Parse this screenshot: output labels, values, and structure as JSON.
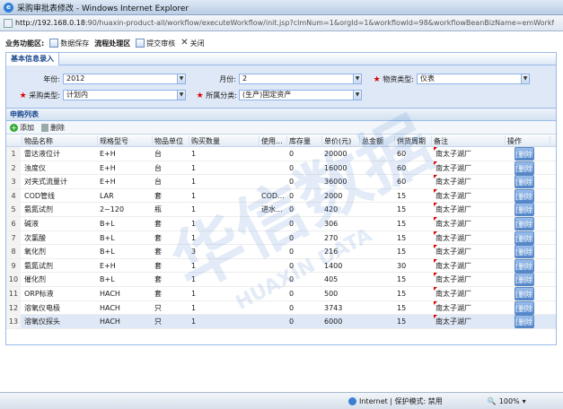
{
  "window": {
    "title": "采购审批表修改 - Windows Internet Explorer",
    "url_host": "http://192.168.0.18",
    "url_rest": ":90/huaxin-product-all/workflow/executeWorkflow/init.jsp?clmNum=1&orgId=1&workflowId=98&workflowBeanBizName=emWorkflowBiz&app"
  },
  "toolbar": {
    "area1_label": "业务功能区:",
    "save_label": "数据保存",
    "area2_label": "流程处理区",
    "submit_label": "提交审核",
    "close_label": "关闭"
  },
  "basic_info": {
    "tab_label": "基本信息录入",
    "year_label": "年份:",
    "year_value": "2012",
    "month_label": "月份:",
    "month_value": "2",
    "material_type_label": "物资类型:",
    "material_type_value": "仪表",
    "purchase_type_label": "采购类型:",
    "purchase_type_value": "计划内",
    "category_label": "所属分类:",
    "category_value": "(生产)固定资产"
  },
  "purchase_list": {
    "header": "申购列表",
    "add_label": "添加",
    "delete_label": "删除",
    "columns": [
      "物品名称",
      "规格型号",
      "物品单位",
      "购买数量",
      "使用...",
      "库存量",
      "单价(元)",
      "总金额",
      "供货周期",
      "备注",
      "操作"
    ],
    "rows": [
      {
        "no": "1",
        "name": "雷达液位计",
        "model": "E+H",
        "unit": "台",
        "qty": "1",
        "use": "",
        "stock": "0",
        "price": "20000",
        "total": "",
        "period": "60",
        "note": "南太子湖厂",
        "op": "[删除]"
      },
      {
        "no": "2",
        "name": "浊度仪",
        "model": "E+H",
        "unit": "台",
        "qty": "1",
        "use": "",
        "stock": "0",
        "price": "16000",
        "total": "",
        "period": "60",
        "note": "南太子湖厂",
        "op": "[删除]"
      },
      {
        "no": "3",
        "name": "对夹式流量计",
        "model": "E+H",
        "unit": "台",
        "qty": "1",
        "use": "",
        "stock": "0",
        "price": "36000",
        "total": "",
        "period": "60",
        "note": "南太子湖厂",
        "op": "[删除]"
      },
      {
        "no": "4",
        "name": "COD管线",
        "model": "LAR",
        "unit": "套",
        "qty": "1",
        "use": "COD...",
        "stock": "0",
        "price": "2000",
        "total": "",
        "period": "15",
        "note": "南太子湖厂",
        "op": "[删除]"
      },
      {
        "no": "5",
        "name": "氨氮试剂",
        "model": "2~120",
        "unit": "瓶",
        "qty": "1",
        "use": "进水...",
        "stock": "0",
        "price": "420",
        "total": "",
        "period": "15",
        "note": "南太子湖厂",
        "op": "[删除]"
      },
      {
        "no": "6",
        "name": "碱液",
        "model": "B+L",
        "unit": "套",
        "qty": "1",
        "use": "",
        "stock": "0",
        "price": "306",
        "total": "",
        "period": "15",
        "note": "南太子湖厂",
        "op": "[删除]"
      },
      {
        "no": "7",
        "name": "次氯酸",
        "model": "B+L",
        "unit": "套",
        "qty": "1",
        "use": "",
        "stock": "0",
        "price": "270",
        "total": "",
        "period": "15",
        "note": "南太子湖厂",
        "op": "[删除]"
      },
      {
        "no": "8",
        "name": "氧化剂",
        "model": "B+L",
        "unit": "套",
        "qty": "3",
        "use": "",
        "stock": "0",
        "price": "216",
        "total": "",
        "period": "15",
        "note": "南太子湖厂",
        "op": "[删除]"
      },
      {
        "no": "9",
        "name": "氨氮试剂",
        "model": "E+H",
        "unit": "套",
        "qty": "1",
        "use": "",
        "stock": "0",
        "price": "1400",
        "total": "",
        "period": "30",
        "note": "南太子湖厂",
        "op": "[删除]"
      },
      {
        "no": "10",
        "name": "催化剂",
        "model": "B+L",
        "unit": "套",
        "qty": "1",
        "use": "",
        "stock": "0",
        "price": "405",
        "total": "",
        "period": "15",
        "note": "南太子湖厂",
        "op": "[删除]"
      },
      {
        "no": "11",
        "name": "ORP标液",
        "model": "HACH",
        "unit": "套",
        "qty": "1",
        "use": "",
        "stock": "0",
        "price": "500",
        "total": "",
        "period": "15",
        "note": "南太子湖厂",
        "op": "[删除]"
      },
      {
        "no": "12",
        "name": "溶氧仪电极",
        "model": "HACH",
        "unit": "只",
        "qty": "1",
        "use": "",
        "stock": "0",
        "price": "3743",
        "total": "",
        "period": "15",
        "note": "南太子湖厂",
        "op": "[删除]"
      },
      {
        "no": "13",
        "name": "溶氧仪探头",
        "model": "HACH",
        "unit": "只",
        "qty": "1",
        "use": "",
        "stock": "0",
        "price": "6000",
        "total": "",
        "period": "15",
        "note": "南太子湖厂",
        "op": "[删除]"
      }
    ]
  },
  "watermark": {
    "text_cn": "华信数据",
    "text_en": "HUAXIN DATA"
  },
  "statusbar": {
    "zone": "Internet | 保护模式: 禁用",
    "zoom": "100%"
  }
}
